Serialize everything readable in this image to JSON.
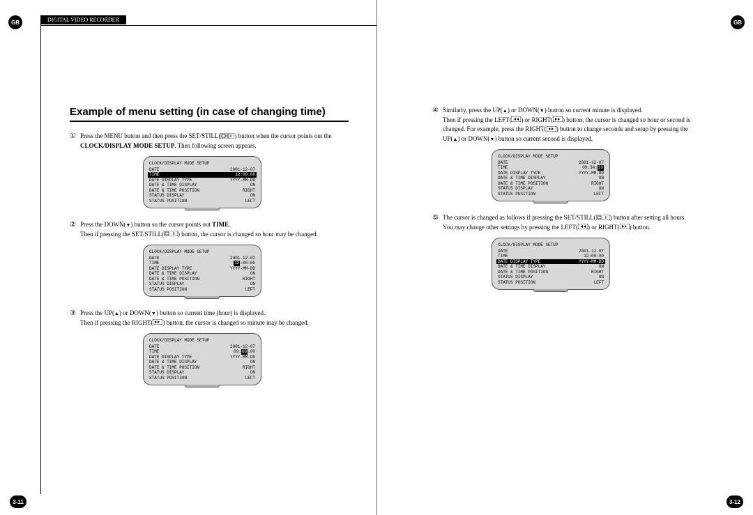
{
  "header": {
    "gb": "GB",
    "tab": "DIGITAL VIDEO RECORDER",
    "pn_left": "3-11",
    "pn_right": "3-12"
  },
  "title": "Example of menu setting (in case of changing time)",
  "steps": {
    "s1": {
      "num": "①",
      "text_a": "Press the MENU button and then press the SET/STILL(",
      "text_b": ") button when the cursor points out the ",
      "text_c": "CLOCK/DISPLAY MODE SETUP",
      "text_d": ". Then following screen appears."
    },
    "s2": {
      "num": "②",
      "text_a": "Press the DOWN(",
      "text_b": ") button so the cursor points out ",
      "text_c": "TIME",
      "text_d": ".",
      "cont": "Then if pressing the SET/STILL(",
      "cont_b": ") button, the cursor is changed so hour may be changed."
    },
    "s3": {
      "num": "③",
      "text_a": "Press the UP(",
      "text_b": ") or DOWN(",
      "text_c": ") button so current time (hour) is displayed.",
      "cont_a": "Then if pressing the RIGHT(",
      "cont_b": ") button, the cursor is changed so minute may be changed."
    },
    "s4": {
      "num": "④",
      "text_a": "Similarly, press the UP(",
      "text_b": ") or DOWN(",
      "text_c": ") button so current minute is displayed.",
      "cont_a": "Then if pressing the LEFT(",
      "cont_b": ") or RIGHT(",
      "cont_c": ") button, the cursor is changed so hour or second is changed. For example, press the RIGHT(",
      "cont_d": ") button to change seconds and setup by pressing the UP(",
      "cont_e": ") or DOWN(",
      "cont_f": ") button so current second is displayed."
    },
    "s5": {
      "num": "⑤",
      "text_a": "The cursor is changed as follows if pressing the SET/STILL(",
      "text_b": ") button after setting all hours. You may change other settings by pressing the LEFT(",
      "text_c": ") or RIGHT(",
      "text_d": ") button."
    }
  },
  "tv": {
    "title": "CLOCK/DISPLAY MODE SETUP",
    "rows": {
      "date_l": "DATE",
      "date_v": "2001-12-07",
      "time_l": "TIME",
      "ddt_l": "DATE DISPLAY TYPE",
      "ddt_v": "YYYY-MM-DD",
      "dtd_l": "DATE & TIME DISPLAY",
      "dtd_v": "ON",
      "dtp_l": "DATE & TIME POSITION",
      "dtp_v": "RIGHT",
      "sd_l": "STATUS DISPLAY",
      "sd_v": "ON",
      "sp_l": "STATUS POSITION",
      "sp_v": "LEFT"
    },
    "tv1_time": "12:00:00",
    "tv2_time_a": "12",
    "tv2_time_b": ":00:00",
    "tv3_time_a": "09:",
    "tv3_time_b": "00",
    "tv3_time_c": ":00",
    "tv4_time_a": "09:34:",
    "tv4_time_b": "10",
    "tv5_time": "12:00:00"
  }
}
